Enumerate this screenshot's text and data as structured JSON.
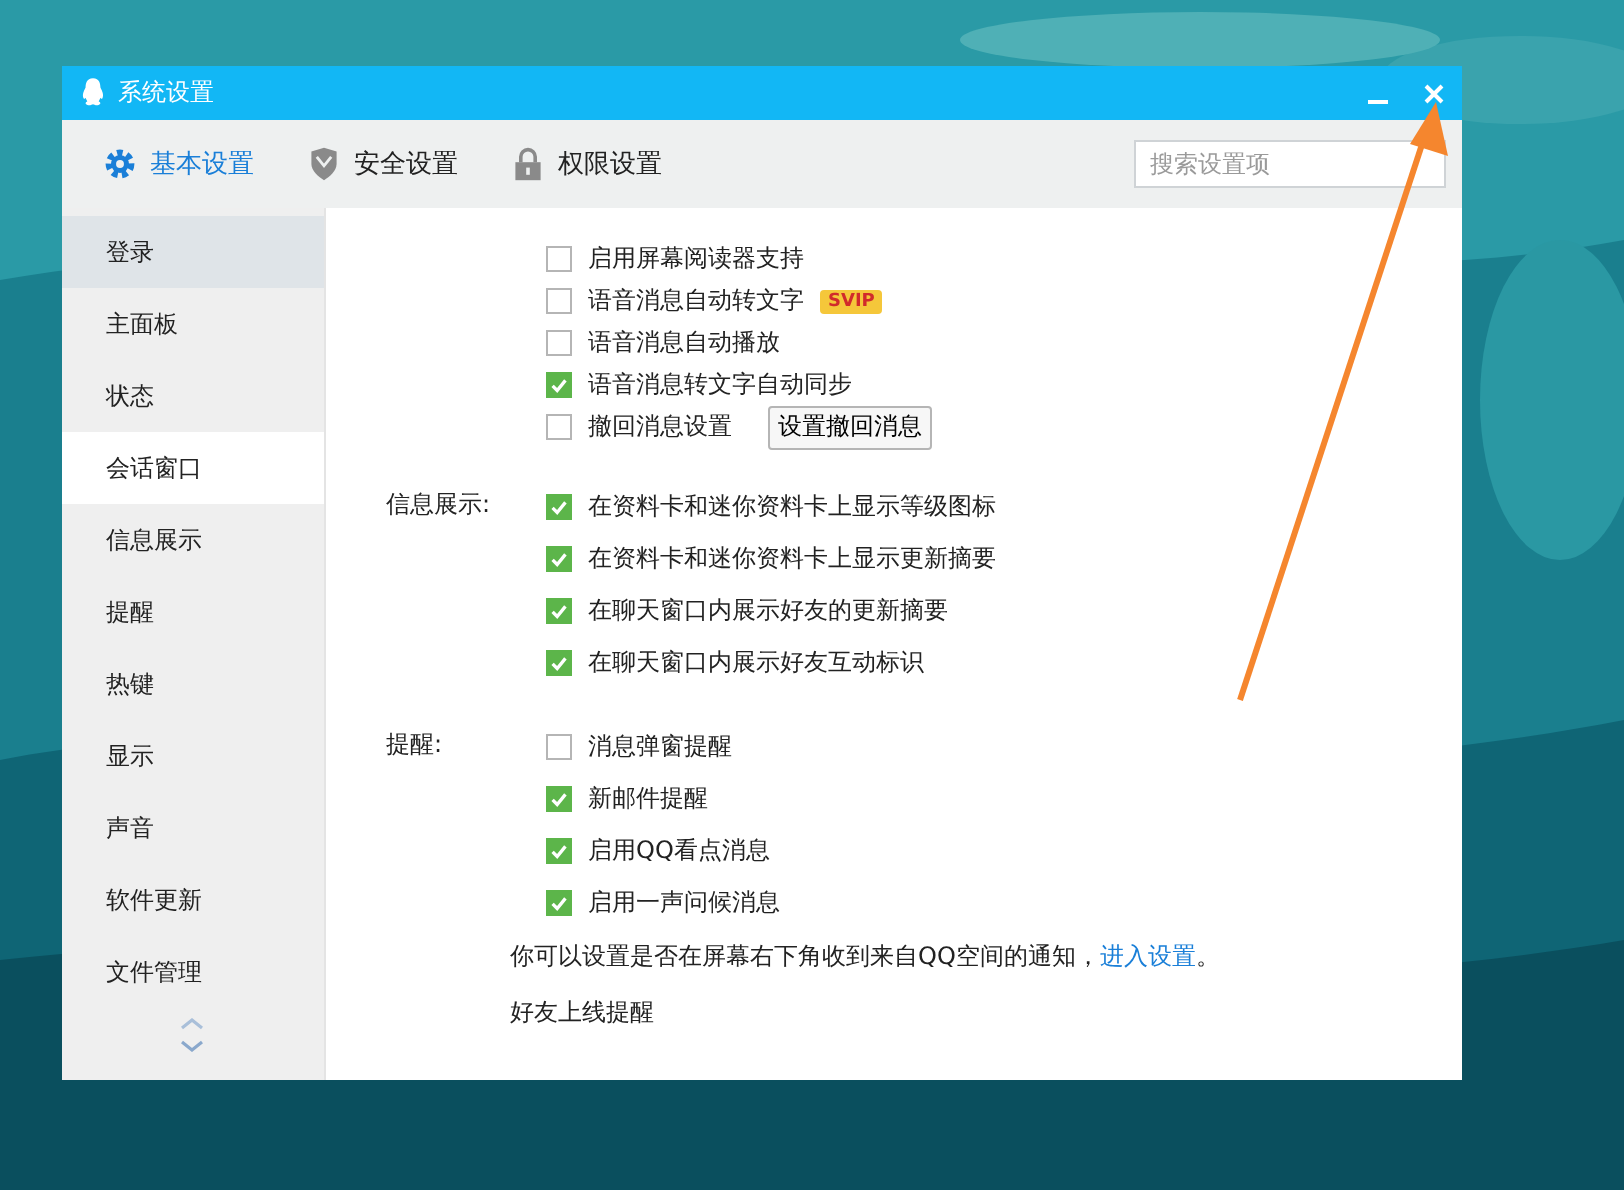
{
  "window": {
    "title": "系统设置"
  },
  "tabs": [
    {
      "label": "基本设置",
      "selected": true
    },
    {
      "label": "安全设置",
      "selected": false
    },
    {
      "label": "权限设置",
      "selected": false
    }
  ],
  "search": {
    "placeholder": "搜索设置项"
  },
  "sidebar": {
    "items": [
      {
        "label": "登录",
        "selected": false,
        "hover": true
      },
      {
        "label": "主面板",
        "selected": false,
        "hover": false
      },
      {
        "label": "状态",
        "selected": false,
        "hover": false
      },
      {
        "label": "会话窗口",
        "selected": true,
        "hover": false
      },
      {
        "label": "信息展示",
        "selected": false,
        "hover": false
      },
      {
        "label": "提醒",
        "selected": false,
        "hover": false
      },
      {
        "label": "热键",
        "selected": false,
        "hover": false
      },
      {
        "label": "显示",
        "selected": false,
        "hover": false
      },
      {
        "label": "声音",
        "selected": false,
        "hover": false
      },
      {
        "label": "软件更新",
        "selected": false,
        "hover": false
      },
      {
        "label": "文件管理",
        "selected": false,
        "hover": false
      }
    ]
  },
  "sections": [
    {
      "items": [
        {
          "kind": "checkbox",
          "text": "启用屏幕阅读器支持",
          "checked": false
        },
        {
          "kind": "checkbox",
          "text": "语音消息自动转文字",
          "checked": false,
          "badge": "SVIP"
        },
        {
          "kind": "checkbox",
          "text": "语音消息自动播放",
          "checked": false
        },
        {
          "kind": "checkbox",
          "text": "语音消息转文字自动同步",
          "checked": true
        },
        {
          "kind": "checkbox",
          "text": "撤回消息设置",
          "checked": false,
          "button": "设置撤回消息"
        }
      ]
    },
    {
      "label": "信息展示:",
      "items": [
        {
          "kind": "checkbox",
          "text": "在资料卡和迷你资料卡上显示等级图标",
          "checked": true
        },
        {
          "kind": "checkbox",
          "text": "在资料卡和迷你资料卡上显示更新摘要",
          "checked": true
        },
        {
          "kind": "checkbox",
          "text": "在聊天窗口内展示好友的更新摘要",
          "checked": true
        },
        {
          "kind": "checkbox",
          "text": "在聊天窗口内展示好友互动标识",
          "checked": true
        }
      ]
    },
    {
      "label": "提醒:",
      "items": [
        {
          "kind": "checkbox",
          "text": "消息弹窗提醒",
          "checked": false
        },
        {
          "kind": "checkbox",
          "text": "新邮件提醒",
          "checked": true
        },
        {
          "kind": "checkbox",
          "text": "启用QQ看点消息",
          "checked": true
        },
        {
          "kind": "checkbox",
          "text": "启用一声问候消息",
          "checked": true
        },
        {
          "kind": "note",
          "text": "你可以设置是否在屏幕右下角收到来自QQ空间的通知，",
          "link": "进入设置",
          "tail": "。"
        },
        {
          "kind": "heading",
          "text": "好友上线提醒"
        }
      ]
    }
  ]
}
